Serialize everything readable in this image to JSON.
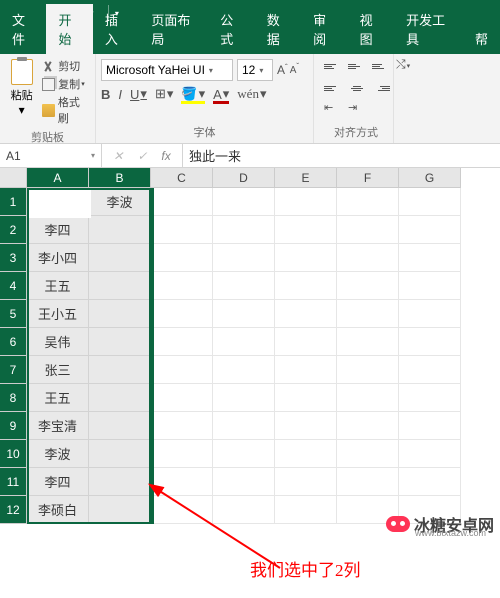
{
  "qat": {
    "save_icon": "save-icon",
    "undo_icon": "undo-icon",
    "redo_icon": "redo-icon"
  },
  "tabs": {
    "file": "文件",
    "home": "开始",
    "insert": "插入",
    "layout": "页面布局",
    "formulas": "公式",
    "data": "数据",
    "review": "审阅",
    "view": "视图",
    "dev": "开发工具",
    "help": "帮"
  },
  "ribbon": {
    "clipboard": {
      "label": "剪贴板",
      "paste": "粘贴",
      "cut": "剪切",
      "copy": "复制",
      "format_painter": "格式刷"
    },
    "font": {
      "label": "字体",
      "name": "Microsoft YaHei UI",
      "size": "12",
      "increase": "A",
      "decrease": "A"
    },
    "align": {
      "label": "对齐方式"
    }
  },
  "formula_bar": {
    "name_box": "A1",
    "value": "独此一来"
  },
  "columns": [
    "A",
    "B",
    "C",
    "D",
    "E",
    "F",
    "G"
  ],
  "rows": [
    "1",
    "2",
    "3",
    "4",
    "5",
    "6",
    "7",
    "8",
    "9",
    "10",
    "11",
    "12"
  ],
  "cells": {
    "A": [
      "独此一来",
      "李四",
      "李小四",
      "王五",
      "王小五",
      "吴伟",
      "张三",
      "王五",
      "李宝清",
      "李波",
      "李四",
      "李硕白"
    ],
    "B": [
      "李波",
      "",
      "",
      "",
      "",
      "",
      "",
      "",
      "",
      "",
      "",
      ""
    ]
  },
  "annotation": "我们选中了2列",
  "watermark": {
    "text": "冰糖安卓网",
    "url": "www.btxtazw.com"
  }
}
